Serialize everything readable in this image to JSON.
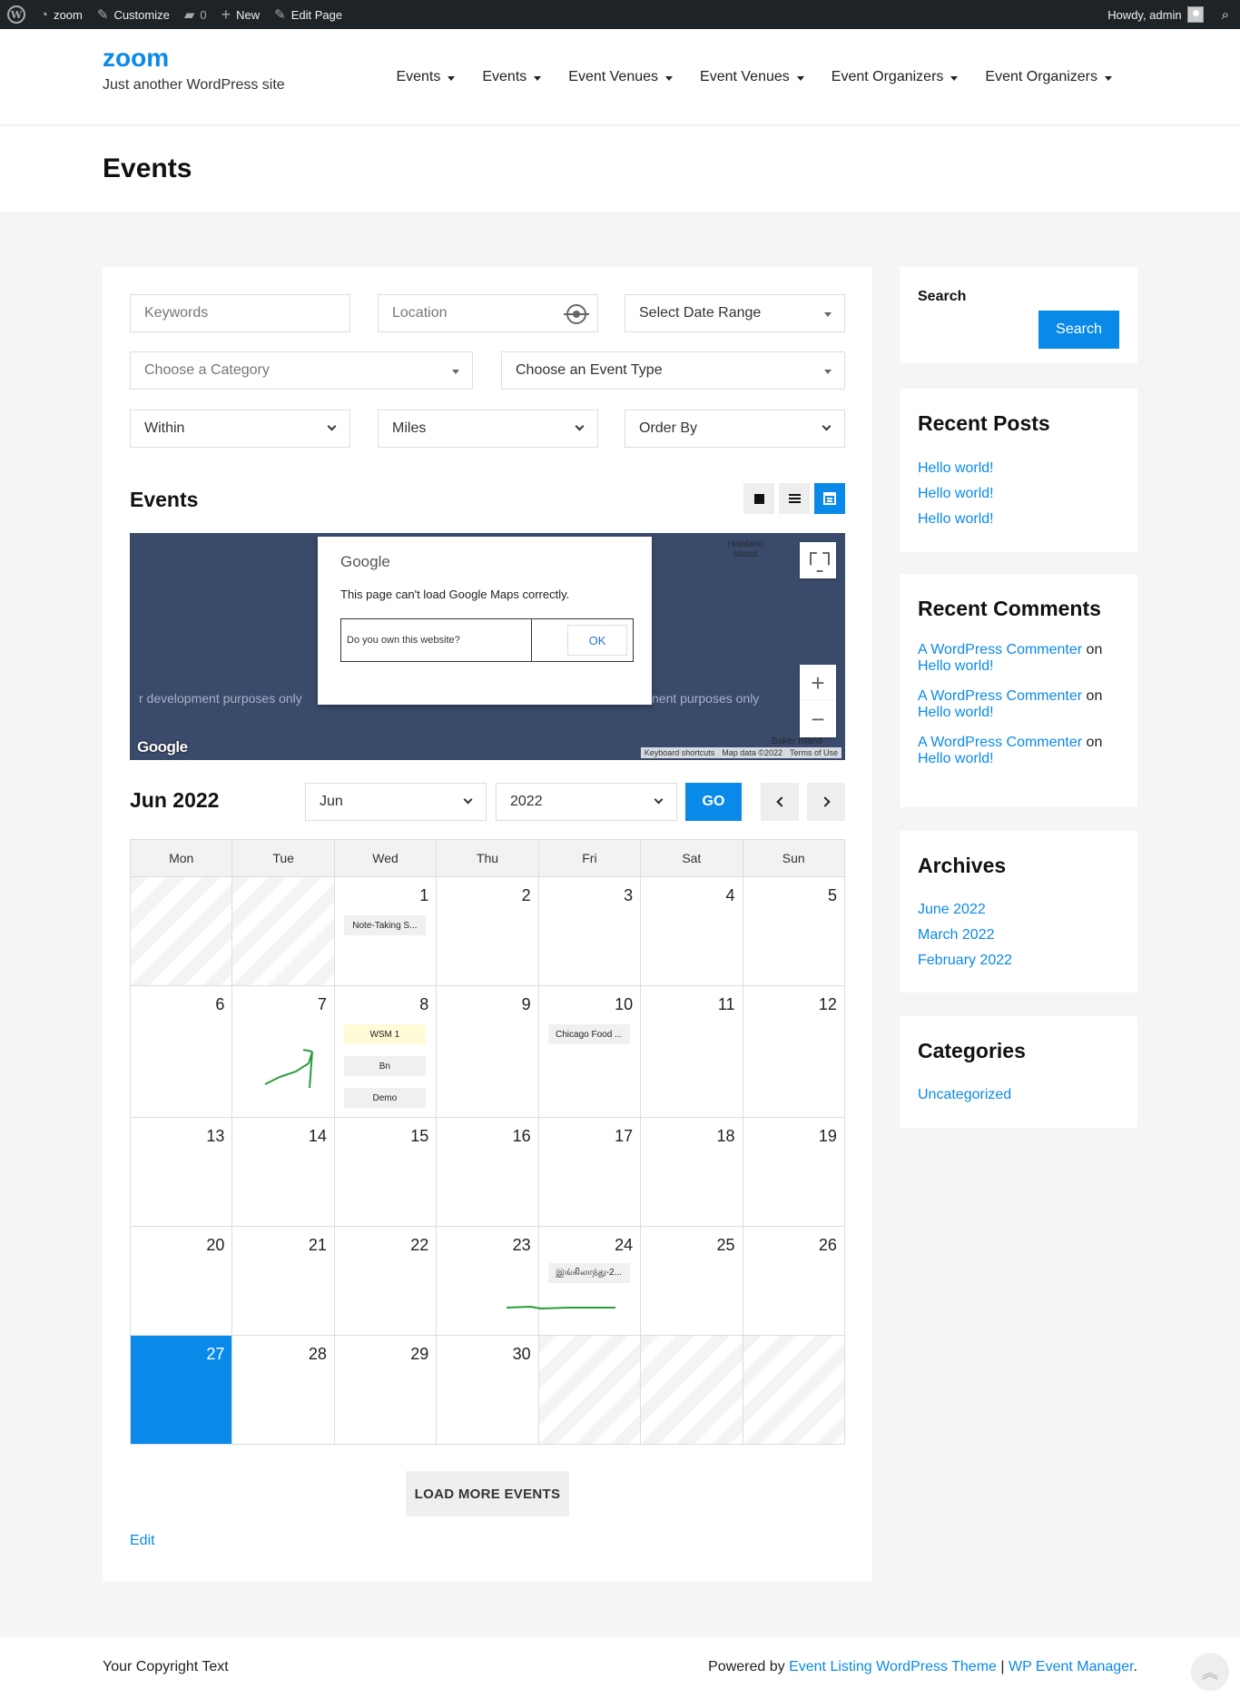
{
  "adminbar": {
    "site": "zoom",
    "customize": "Customize",
    "comments_count": "0",
    "new": "New",
    "edit_page": "Edit Page",
    "howdy": "Howdy, admin"
  },
  "header": {
    "site_title": "zoom",
    "tagline": "Just another WordPress site",
    "nav": [
      "Events",
      "Events",
      "Event Venues",
      "Event Venues",
      "Event Organizers",
      "Event Organizers"
    ]
  },
  "page_title": "Events",
  "filters": {
    "keywords_placeholder": "Keywords",
    "location_placeholder": "Location",
    "date_range": "Select Date Range",
    "category": "Choose a Category",
    "event_type": "Choose an Event Type",
    "within": "Within",
    "miles": "Miles",
    "order_by": "Order By"
  },
  "events_heading": "Events",
  "map": {
    "dev_text_1": "r development purposes only",
    "dev_text_2": "nent purposes only",
    "island_1": "Howland Island",
    "island_2": "Baker Island",
    "google_logo": "Google",
    "footer": [
      "Keyboard shortcuts",
      "Map data ©2022",
      "Terms of Use"
    ],
    "dialog_brand": "Google",
    "dialog_message": "This page can't load Google Maps correctly.",
    "dialog_question": "Do you own this website?",
    "dialog_ok": "OK"
  },
  "calendar": {
    "title": "Jun 2022",
    "month_select": "Jun",
    "year_select": "2022",
    "go": "GO",
    "weekdays": [
      "Mon",
      "Tue",
      "Wed",
      "Thu",
      "Fri",
      "Sat",
      "Sun"
    ],
    "weeks": [
      [
        null,
        null,
        "1",
        "2",
        "3",
        "4",
        "5"
      ],
      [
        "6",
        "7",
        "8",
        "9",
        "10",
        "11",
        "12"
      ],
      [
        "13",
        "14",
        "15",
        "16",
        "17",
        "18",
        "19"
      ],
      [
        "20",
        "21",
        "22",
        "23",
        "24",
        "25",
        "26"
      ],
      [
        "27",
        "28",
        "29",
        "30",
        null,
        null,
        null
      ]
    ],
    "today": "27",
    "events": {
      "1": [
        "Note-Taking S..."
      ],
      "8": [
        "WSM 1",
        "Bn",
        "Demo"
      ],
      "10": [
        "Chicago Food ..."
      ],
      "24": [
        "இங்கிலாந்து-2..."
      ]
    }
  },
  "load_more": "LOAD MORE EVENTS",
  "edit": "Edit",
  "sidebar": {
    "search_title": "Search",
    "search_button": "Search",
    "recent_posts_title": "Recent Posts",
    "recent_posts": [
      "Hello world!",
      "Hello world!",
      "Hello world!"
    ],
    "recent_comments_title": "Recent Comments",
    "recent_comments": [
      {
        "author": "A WordPress Commenter",
        "on": "on",
        "post": "Hello world!"
      },
      {
        "author": "A WordPress Commenter",
        "on": "on",
        "post": "Hello world!"
      },
      {
        "author": "A WordPress Commenter",
        "on": "on",
        "post": "Hello world!"
      }
    ],
    "archives_title": "Archives",
    "archives": [
      "June 2022",
      "March 2022",
      "February 2022"
    ],
    "categories_title": "Categories",
    "categories": [
      "Uncategorized"
    ]
  },
  "footer": {
    "copyright": "Your Copyright Text",
    "powered_by": "Powered by",
    "theme_link": "Event Listing WordPress Theme",
    "separator": "|",
    "plugin_link": "WP Event Manager",
    "period": "."
  },
  "colors": {
    "accent": "#0a8ae8",
    "adminbar": "#1d2327",
    "map": "#3a4a6b"
  }
}
